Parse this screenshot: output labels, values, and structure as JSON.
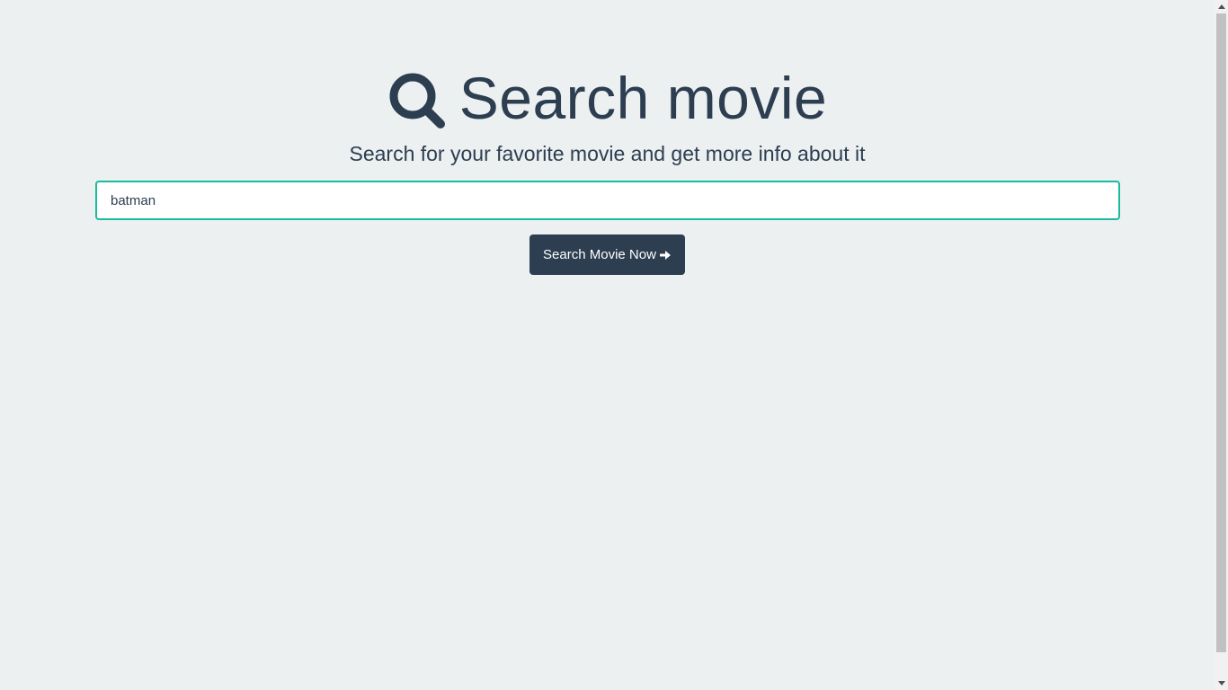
{
  "header": {
    "icon": "search-icon",
    "title": "Search movie",
    "subtitle": "Search for your favorite movie and get more info about it"
  },
  "search": {
    "value": "batman",
    "placeholder": ""
  },
  "button": {
    "label": "Search Movie Now",
    "icon": "arrow-right-icon"
  },
  "colors": {
    "background": "#ecf0f1",
    "text": "#2c3e50",
    "input_border": "#1abc9c",
    "button_bg": "#2c3e50",
    "button_text": "#ffffff"
  }
}
